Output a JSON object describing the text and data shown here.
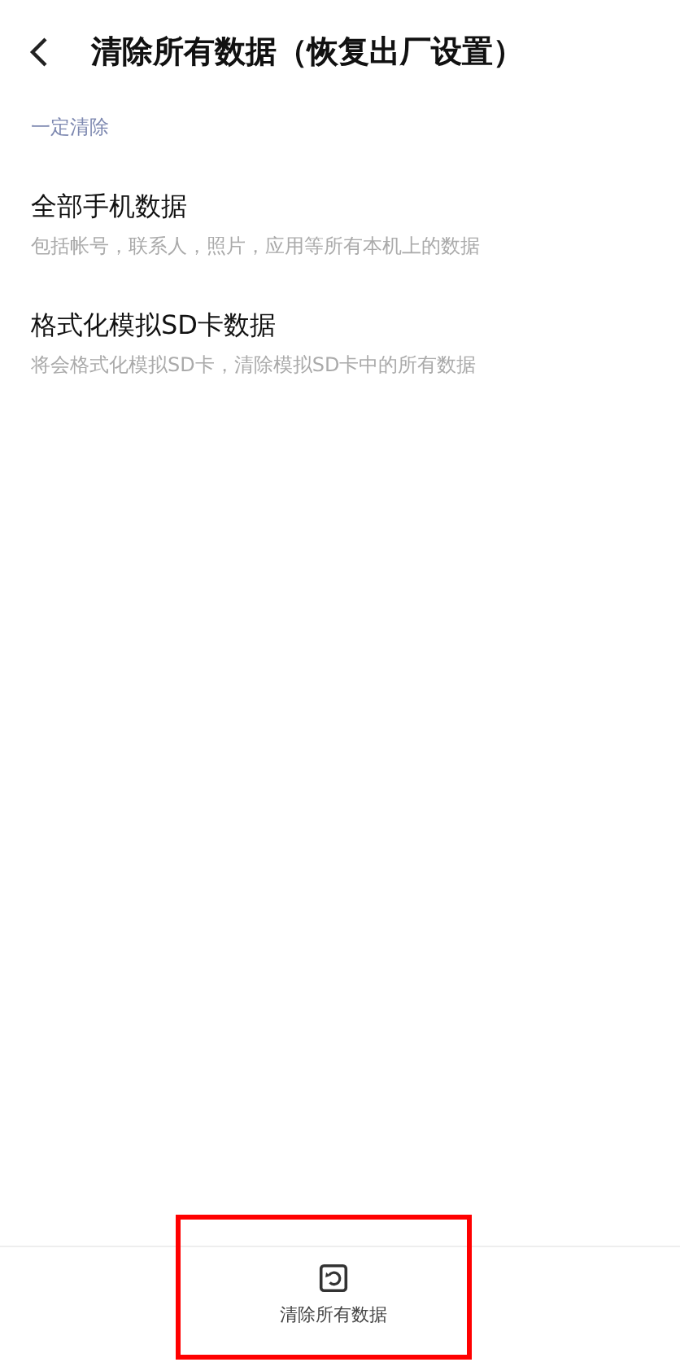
{
  "header": {
    "title": "清除所有数据（恢复出厂设置）"
  },
  "section": {
    "label": "一定清除",
    "items": [
      {
        "title": "全部手机数据",
        "subtitle": "包括帐号，联系人，照片，应用等所有本机上的数据"
      },
      {
        "title": "格式化模拟SD卡数据",
        "subtitle": "将会格式化模拟SD卡，清除模拟SD卡中的所有数据"
      }
    ]
  },
  "bottom_bar": {
    "button": {
      "label": "清除所有数据",
      "highlighted": true
    }
  }
}
